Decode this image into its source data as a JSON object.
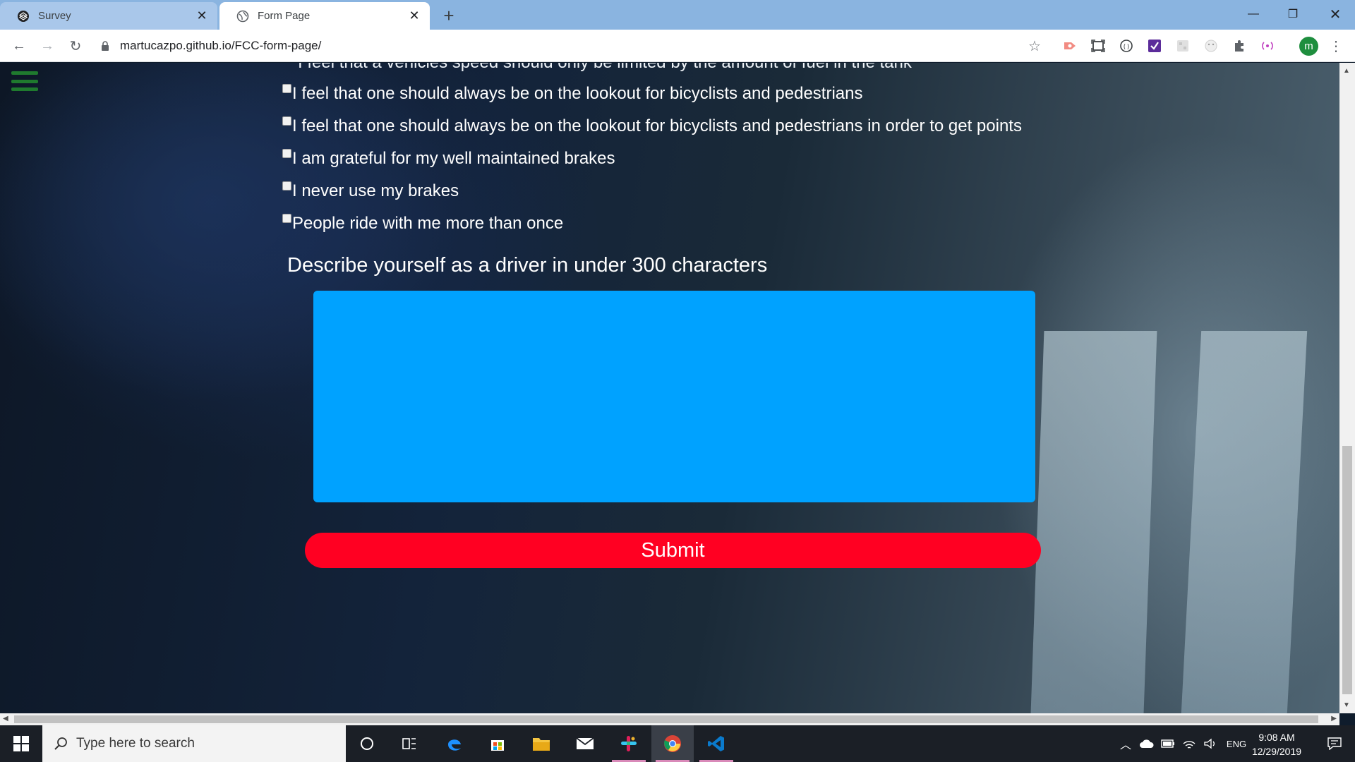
{
  "browser": {
    "tabs": [
      {
        "title": "Survey",
        "icon": "codepen-icon",
        "active": false
      },
      {
        "title": "Form Page",
        "icon": "globe-icon",
        "active": true
      }
    ],
    "new_tab_label": "+",
    "url": "martucazpo.github.io/FCC-form-page/",
    "profile_initial": "m"
  },
  "page": {
    "partial_line": "I feel that a vehicles speed should only be limited by the amount of fuel in the tank",
    "checkboxes": [
      {
        "label": "I feel that one should always be on the lookout for bicyclists and pedestrians",
        "checked": false
      },
      {
        "label": "I feel that one should always be on the lookout for bicyclists and pedestrians in order to get points",
        "checked": false
      },
      {
        "label": "I am grateful for my well maintained brakes",
        "checked": false
      },
      {
        "label": "I never use my brakes",
        "checked": false
      },
      {
        "label": "People ride with me more than once",
        "checked": false
      }
    ],
    "question": "Describe yourself as a driver in under 300 characters",
    "textarea_value": "",
    "submit_label": "Submit",
    "colors": {
      "textarea": "#00a2ff",
      "submit": "#ff0022",
      "hamburger": "#1f7a2e"
    }
  },
  "taskbar": {
    "search_placeholder": "Type here to search",
    "apps": [
      "cortana-icon",
      "task-view-icon",
      "edge-icon",
      "store-icon",
      "file-explorer-icon",
      "mail-icon",
      "slack-icon",
      "chrome-icon",
      "vscode-icon"
    ],
    "language": "ENG",
    "time": "9:08 AM",
    "date": "12/29/2019"
  }
}
